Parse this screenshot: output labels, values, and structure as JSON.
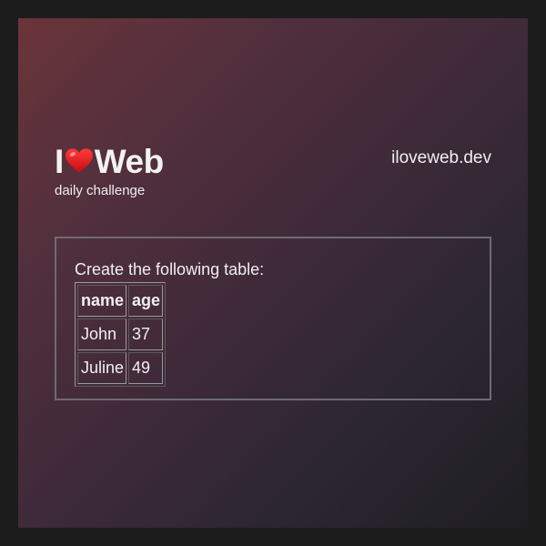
{
  "brand": {
    "logo_prefix": "I",
    "logo_suffix": "Web",
    "tagline": "daily challenge",
    "site": "iloveweb.dev"
  },
  "challenge": {
    "prompt": "Create the following table:",
    "table": {
      "headers": [
        "name",
        "age"
      ],
      "rows": [
        [
          "John",
          "37"
        ],
        [
          "Juline",
          "49"
        ]
      ]
    }
  },
  "colors": {
    "heart": "#e0121a",
    "box_border": "#6e6b72",
    "text": "#f0f0f0"
  },
  "icons": {
    "heart": "heart-icon"
  }
}
